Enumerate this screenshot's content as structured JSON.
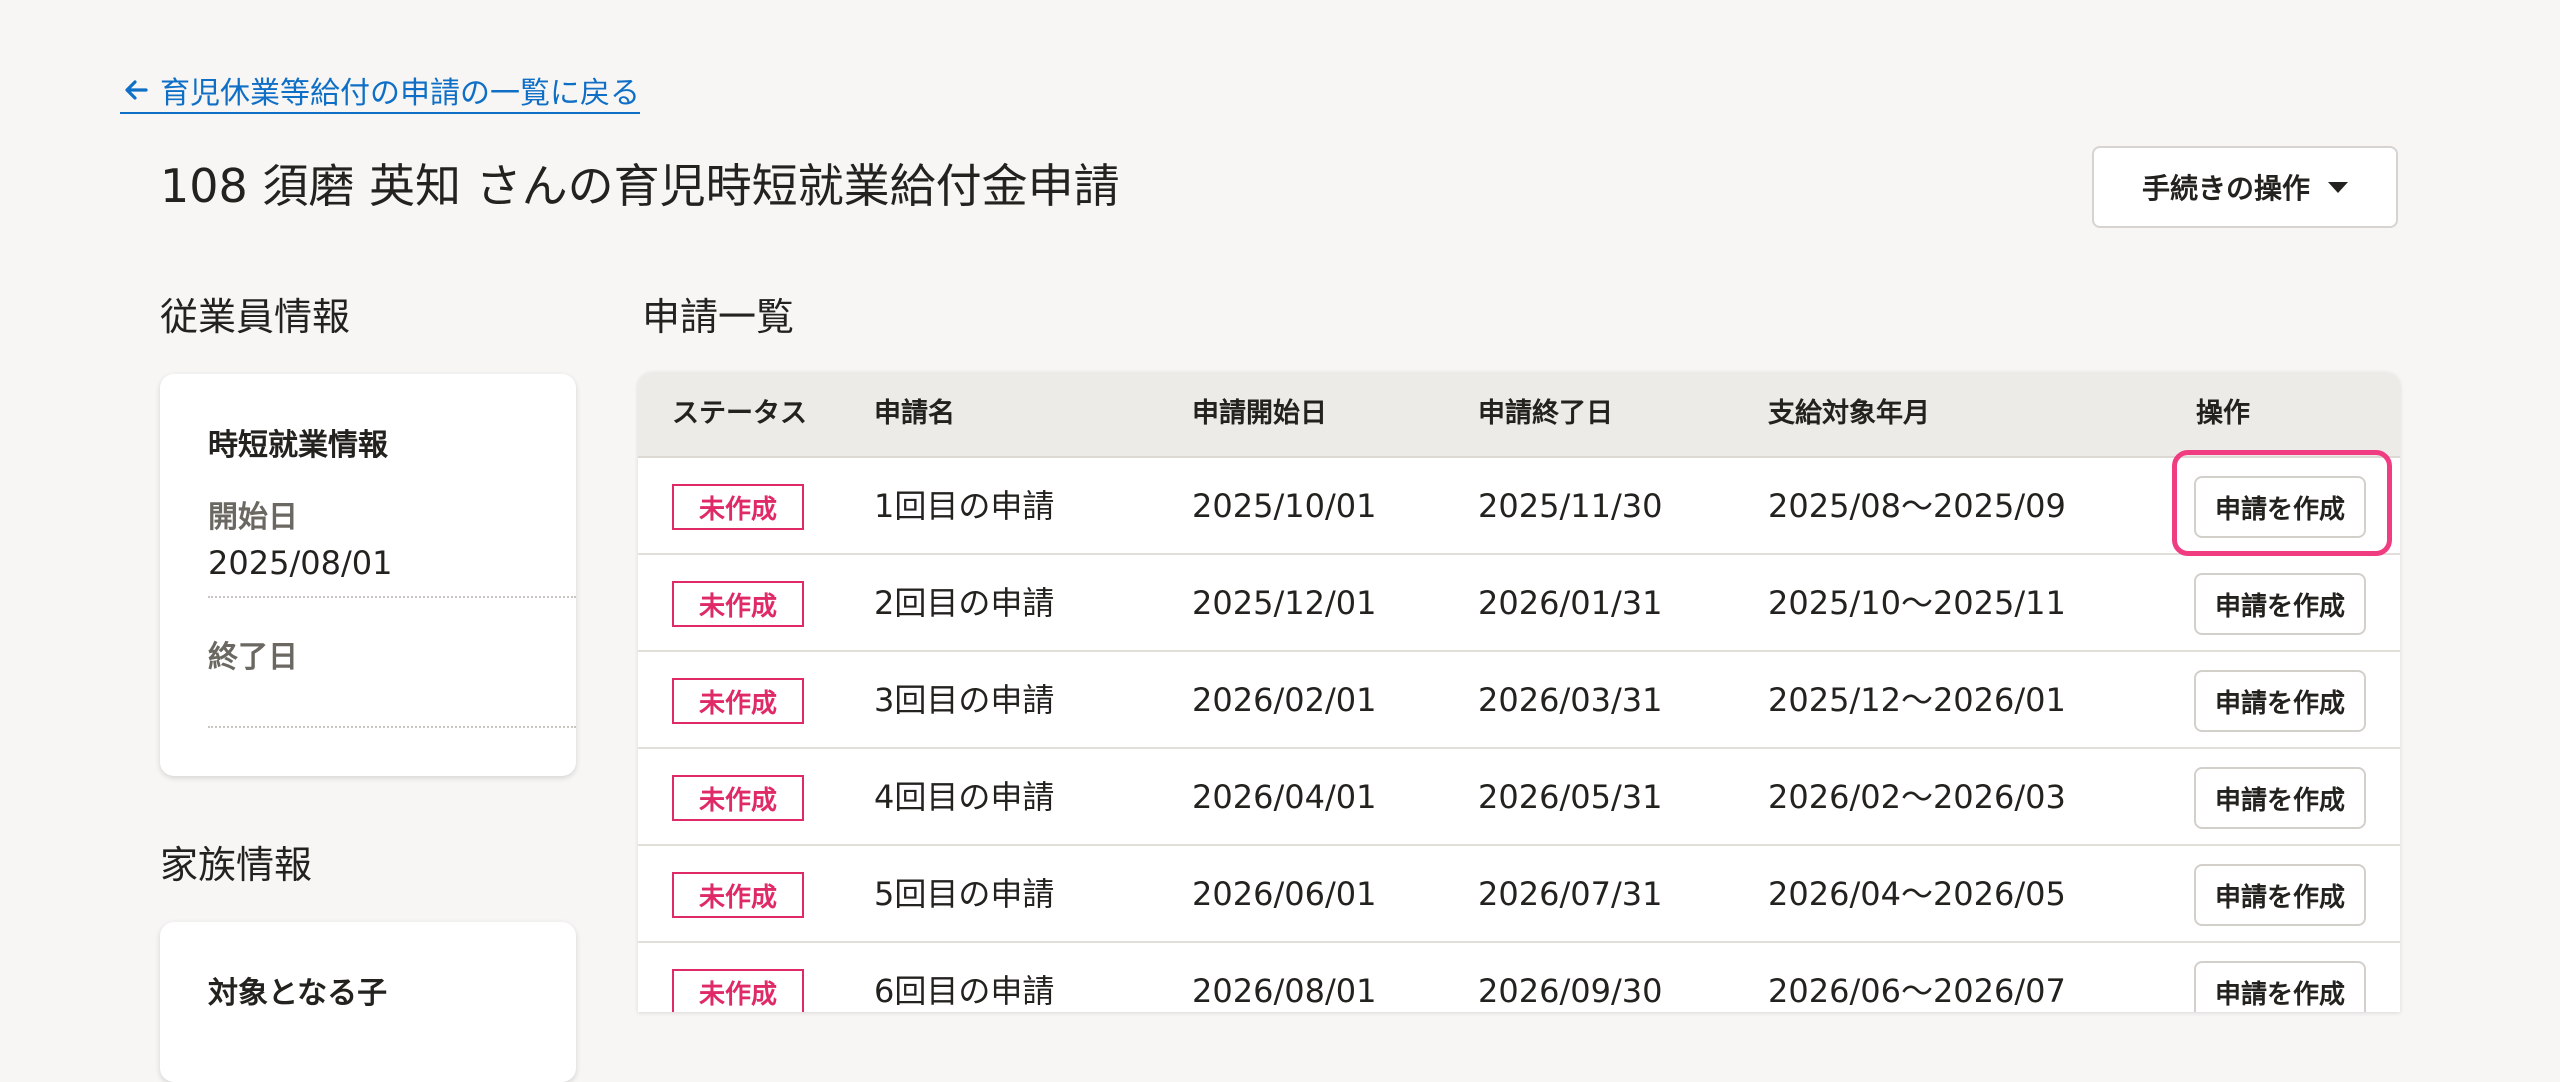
{
  "back_link": {
    "label": "育児休業等給付の申請の一覧に戻る"
  },
  "page_title": "108 須磨 英知 さんの育児時短就業給付金申請",
  "procedure_button": {
    "label": "手続きの操作"
  },
  "employee_section": {
    "title": "従業員情報",
    "card_heading": "時短就業情報",
    "start_label": "開始日",
    "start_value": "2025/08/01",
    "end_label": "終了日",
    "end_value": ""
  },
  "family_section": {
    "title": "家族情報",
    "card_heading": "対象となる子"
  },
  "applications_section": {
    "title": "申請一覧",
    "columns": [
      "ステータス",
      "申請名",
      "申請開始日",
      "申請終了日",
      "支給対象年月",
      "操作"
    ],
    "rows": [
      {
        "status": "未作成",
        "name": "1回目の申請",
        "start": "2025/10/01",
        "end": "2025/11/30",
        "period": "2025/08〜2025/09",
        "action": "申請を作成"
      },
      {
        "status": "未作成",
        "name": "2回目の申請",
        "start": "2025/12/01",
        "end": "2026/01/31",
        "period": "2025/10〜2025/11",
        "action": "申請を作成"
      },
      {
        "status": "未作成",
        "name": "3回目の申請",
        "start": "2026/02/01",
        "end": "2026/03/31",
        "period": "2025/12〜2026/01",
        "action": "申請を作成"
      },
      {
        "status": "未作成",
        "name": "4回目の申請",
        "start": "2026/04/01",
        "end": "2026/05/31",
        "period": "2026/02〜2026/03",
        "action": "申請を作成"
      },
      {
        "status": "未作成",
        "name": "5回目の申請",
        "start": "2026/06/01",
        "end": "2026/07/31",
        "period": "2026/04〜2026/05",
        "action": "申請を作成"
      },
      {
        "status": "未作成",
        "name": "6回目の申請",
        "start": "2026/08/01",
        "end": "2026/09/30",
        "period": "2026/06〜2026/07",
        "action": "申請を作成"
      }
    ]
  },
  "colors": {
    "background": "#f7f6f4",
    "link": "#0f6fc6",
    "status_badge": "#df2a66",
    "highlight": "#f03d82"
  }
}
